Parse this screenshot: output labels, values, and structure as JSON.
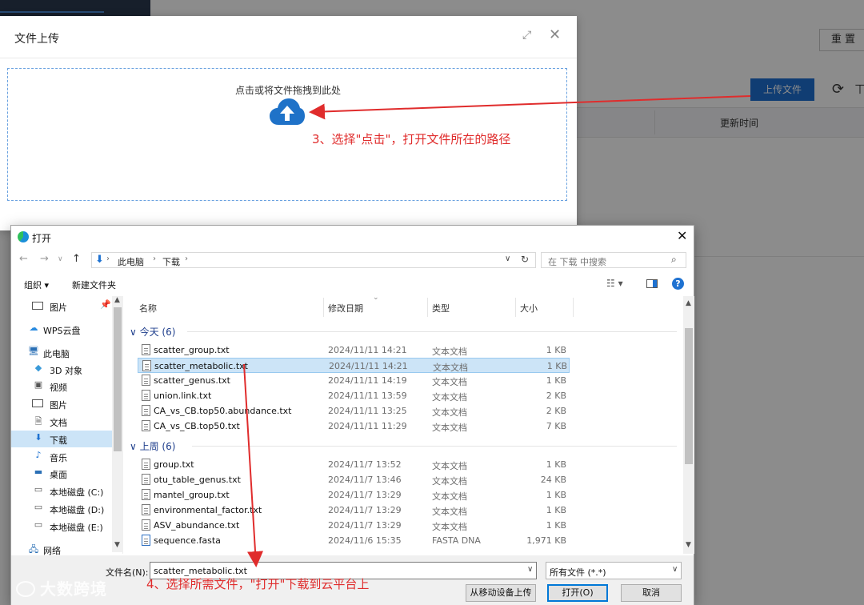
{
  "background_page": {
    "reset_label": "重 置",
    "upload_button_label": "上传文件",
    "column_updated_time": "更新时间"
  },
  "upload_modal": {
    "title": "文件上传",
    "drop_text": "点击或将文件拖拽到此处"
  },
  "annotations": {
    "step3": "3、选择\"点击\"，打开文件所在的路径",
    "step4": "4、选择所需文件，\"打开\"下载到云平台上",
    "arrow_color": "#e02c2c"
  },
  "dialog": {
    "title": "打开",
    "breadcrumb": [
      "此电脑",
      "下载"
    ],
    "search_placeholder": "在 下载 中搜索",
    "toolbar": {
      "organize": "组织 ▾",
      "new_folder": "新建文件夹"
    },
    "sidebar": [
      {
        "icon": "pictures-icon",
        "label": "图片",
        "pinned": true
      },
      {
        "icon": "wps-cloud-icon",
        "label": "WPS云盘"
      },
      {
        "icon": "this-pc-icon",
        "label": "此电脑"
      },
      {
        "icon": "3d-objects-icon",
        "label": "3D 对象"
      },
      {
        "icon": "videos-icon",
        "label": "视频"
      },
      {
        "icon": "pictures-icon",
        "label": "图片"
      },
      {
        "icon": "documents-icon",
        "label": "文档"
      },
      {
        "icon": "downloads-icon",
        "label": "下载",
        "selected": true
      },
      {
        "icon": "music-icon",
        "label": "音乐"
      },
      {
        "icon": "desktop-icon",
        "label": "桌面"
      },
      {
        "icon": "drive-icon",
        "label": "本地磁盘 (C:)"
      },
      {
        "icon": "drive-icon",
        "label": "本地磁盘 (D:)"
      },
      {
        "icon": "drive-icon",
        "label": "本地磁盘 (E:)"
      },
      {
        "icon": "network-icon",
        "label": "网络"
      }
    ],
    "columns": {
      "name": "名称",
      "date": "修改日期",
      "type": "类型",
      "size": "大小"
    },
    "groups": [
      {
        "label": "今天 (6)",
        "files": [
          {
            "name": "scatter_group.txt",
            "date": "2024/11/11 14:21",
            "type": "文本文档",
            "size": "1 KB"
          },
          {
            "name": "scatter_metabolic.txt",
            "date": "2024/11/11 14:21",
            "type": "文本文档",
            "size": "1 KB",
            "selected": true
          },
          {
            "name": "scatter_genus.txt",
            "date": "2024/11/11 14:19",
            "type": "文本文档",
            "size": "1 KB"
          },
          {
            "name": "union.link.txt",
            "date": "2024/11/11 13:59",
            "type": "文本文档",
            "size": "2 KB"
          },
          {
            "name": "CA_vs_CB.top50.abundance.txt",
            "date": "2024/11/11 13:25",
            "type": "文本文档",
            "size": "2 KB"
          },
          {
            "name": "CA_vs_CB.top50.txt",
            "date": "2024/11/11 11:29",
            "type": "文本文档",
            "size": "7 KB"
          }
        ]
      },
      {
        "label": "上周 (6)",
        "files": [
          {
            "name": "group.txt",
            "date": "2024/11/7 13:52",
            "type": "文本文档",
            "size": "1 KB"
          },
          {
            "name": "otu_table_genus.txt",
            "date": "2024/11/7 13:46",
            "type": "文本文档",
            "size": "24 KB"
          },
          {
            "name": "mantel_group.txt",
            "date": "2024/11/7 13:29",
            "type": "文本文档",
            "size": "1 KB"
          },
          {
            "name": "environmental_factor.txt",
            "date": "2024/11/7 13:29",
            "type": "文本文档",
            "size": "1 KB"
          },
          {
            "name": "ASV_abundance.txt",
            "date": "2024/11/7 13:29",
            "type": "文本文档",
            "size": "1 KB"
          },
          {
            "name": "sequence.fasta",
            "date": "2024/11/6 15:35",
            "type": "FASTA DNA",
            "size": "1,971 KB"
          }
        ]
      }
    ],
    "footer": {
      "filename_label": "文件名(N):",
      "filename_value": "scatter_metabolic.txt",
      "filetype_value": "所有文件 (*.*)",
      "mobile_button": "从移动设备上传",
      "open_button": "打开(O)",
      "cancel_button": "取消"
    }
  },
  "watermark": "大数跨境"
}
